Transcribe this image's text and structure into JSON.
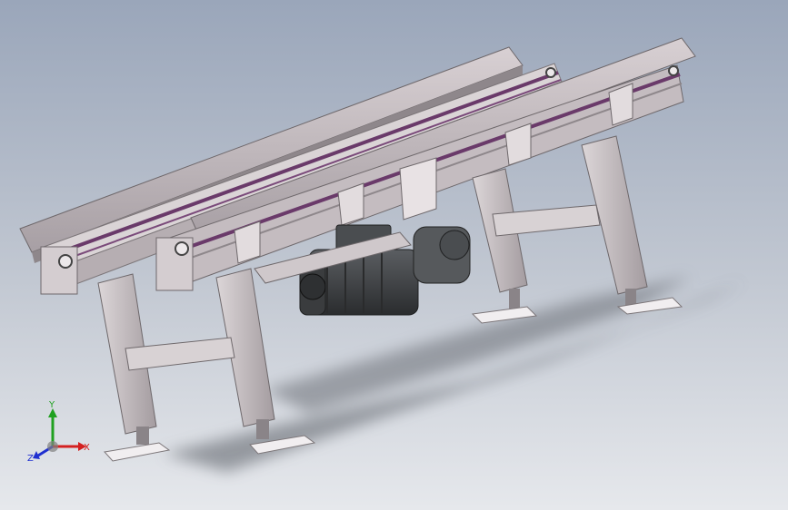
{
  "viewport": {
    "background_top": "#9aa6ba",
    "background_bottom": "#e6e8ec"
  },
  "model": {
    "frame_color": "#c9c1c4",
    "belt_color": "#6a3a6a",
    "motor_color": "#3b3d40",
    "shadow_color": "#5a5e66"
  },
  "triad": {
    "x_label": "X",
    "y_label": "Y",
    "z_label": "Z",
    "x_color": "#d42020",
    "y_color": "#20a020",
    "z_color": "#2030d0"
  }
}
